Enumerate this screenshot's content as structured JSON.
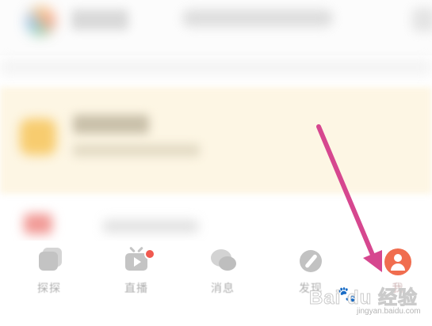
{
  "tabbar": {
    "tabs": [
      {
        "id": "discover-feed",
        "label": "探探",
        "icon": "stacked-cards-icon",
        "active": false
      },
      {
        "id": "live",
        "label": "直播",
        "icon": "live-tv-icon",
        "active": false,
        "badge_color": "#f0594f"
      },
      {
        "id": "messages",
        "label": "消息",
        "icon": "chat-bubbles-icon",
        "active": false
      },
      {
        "id": "discover",
        "label": "发现",
        "icon": "compass-icon",
        "active": false
      },
      {
        "id": "me",
        "label": "我",
        "icon": "avatar-icon",
        "active": true
      }
    ]
  },
  "annotation": {
    "arrow_color": "#d6478f"
  },
  "watermark": {
    "brand": "Bai du 经验",
    "site": "jingyan.baidu.com"
  },
  "colors": {
    "avatar": "#f06d4f",
    "banner": "#fdf6e4",
    "icon_inactive": "#c3c3c3"
  }
}
